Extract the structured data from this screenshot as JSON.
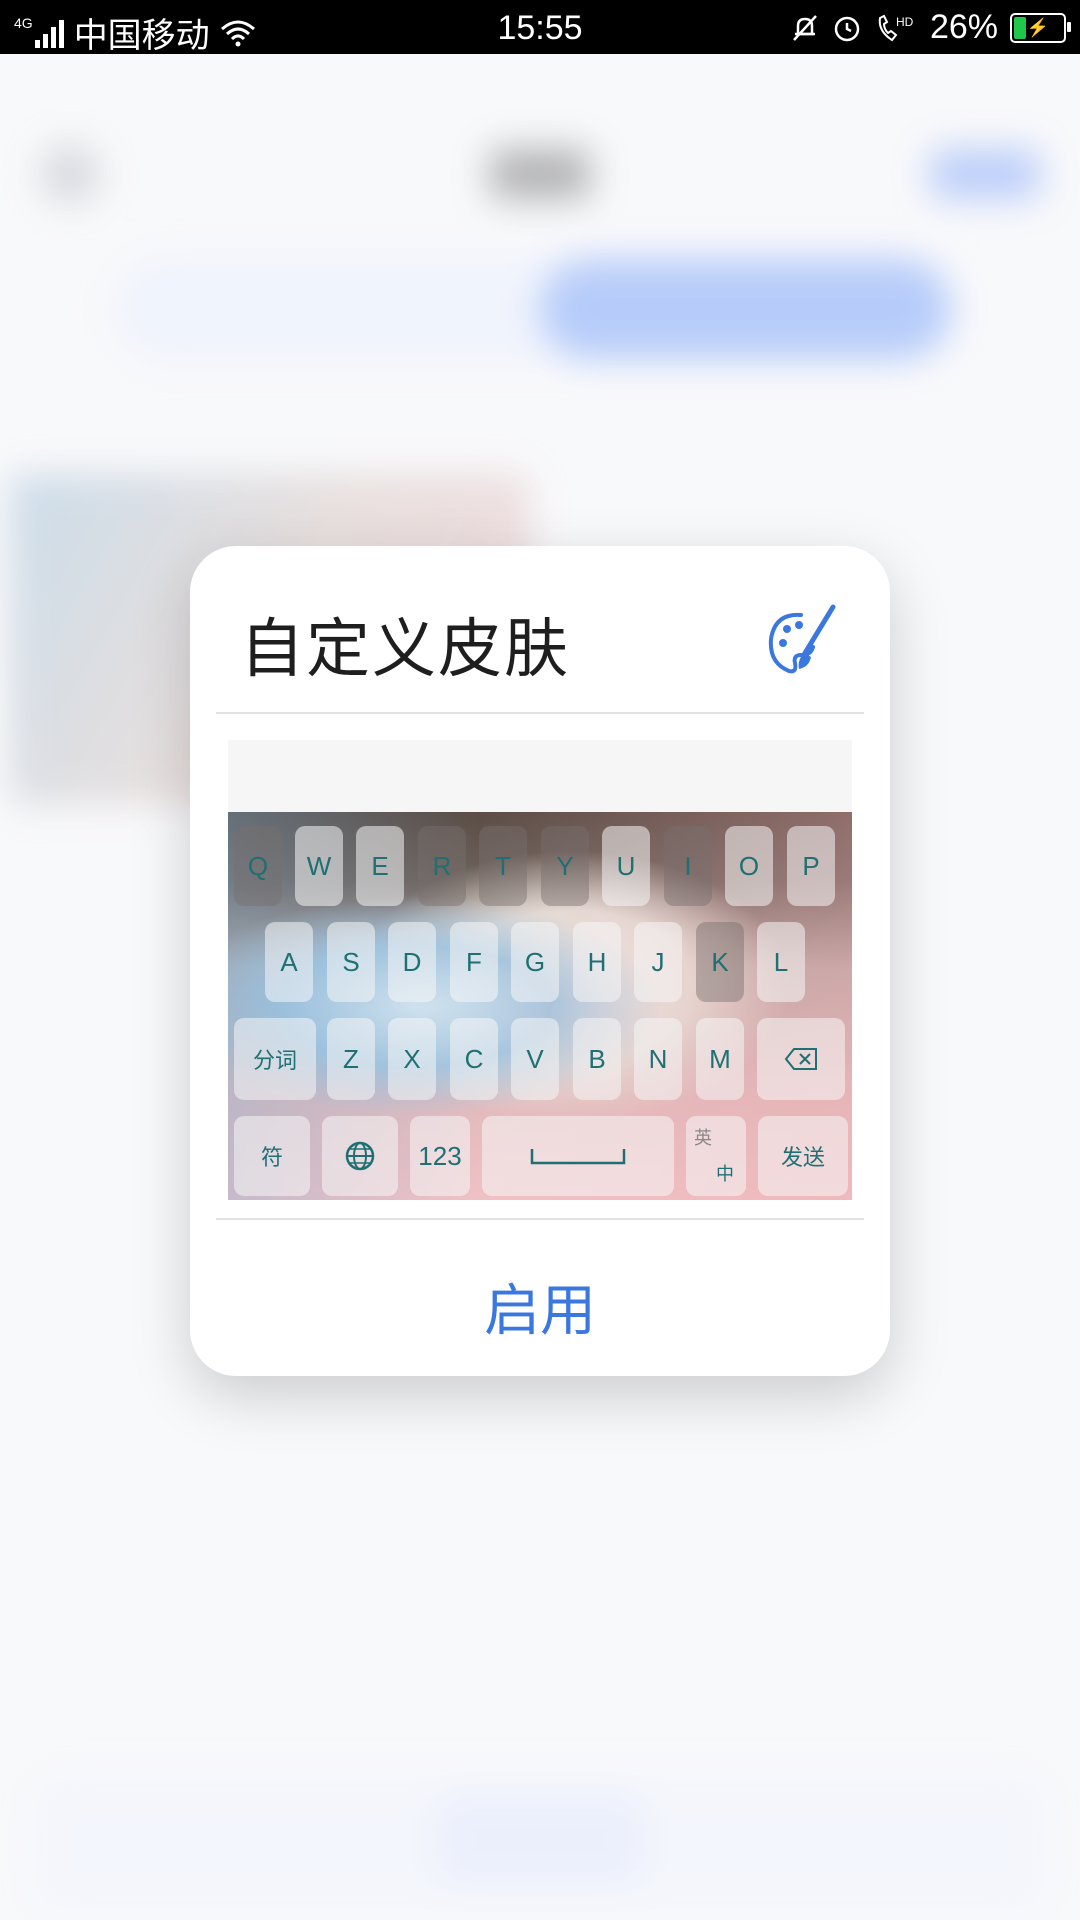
{
  "status_bar": {
    "network": "4G",
    "carrier": "中国移动",
    "time": "15:55",
    "battery_percent": "26%",
    "battery_level": 0.26,
    "icons": [
      "signal-icon",
      "wifi-icon",
      "mute-bell-icon",
      "alarm-icon",
      "hd-call-icon",
      "battery-charging-icon"
    ]
  },
  "dialog": {
    "title": "自定义皮肤",
    "title_icon": "palette-brush-icon",
    "enable_label": "启用",
    "accent_color": "#3a78e0"
  },
  "keyboard_preview": {
    "row1": [
      "Q",
      "W",
      "E",
      "R",
      "T",
      "Y",
      "U",
      "I",
      "O",
      "P"
    ],
    "row2": [
      "A",
      "S",
      "D",
      "F",
      "G",
      "H",
      "J",
      "K",
      "L"
    ],
    "row3": [
      "分词",
      "Z",
      "X",
      "C",
      "V",
      "B",
      "N",
      "M"
    ],
    "row4": {
      "symbols": "符",
      "numbers": "123",
      "lang_top": "英",
      "lang_bottom": "中",
      "send": "发送"
    }
  }
}
